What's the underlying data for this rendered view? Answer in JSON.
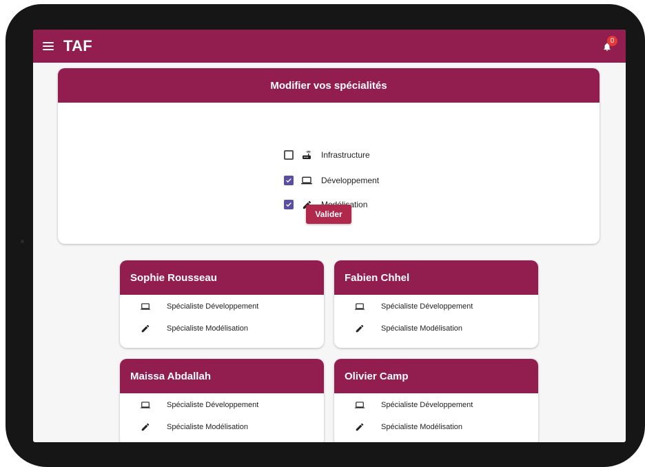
{
  "app": {
    "title": "TAF",
    "notification_count": "0"
  },
  "icons": {
    "menu": "menu-icon",
    "bell": "bell-icon",
    "infrastructure": "router-icon",
    "development": "laptop-icon",
    "modeling": "pencil-icon"
  },
  "colors": {
    "primary": "#921e4f",
    "button": "#b0284c",
    "checkbox": "#5a4ea0",
    "badge": "#e53935"
  },
  "edit": {
    "title": "Modifier vos spécialités",
    "options": [
      {
        "label": "Infrastructure",
        "checked": false
      },
      {
        "label": "Développement",
        "checked": true
      },
      {
        "label": "Modélisation",
        "checked": true
      }
    ],
    "submit_label": "Valider"
  },
  "users": [
    {
      "name": "Sophie Rousseau",
      "specs": [
        "Spécialiste Développement",
        "Spécialiste Modélisation"
      ]
    },
    {
      "name": "Fabien Chhel",
      "specs": [
        "Spécialiste Développement",
        "Spécialiste Modélisation"
      ]
    },
    {
      "name": "Maissa Abdallah",
      "specs": [
        "Spécialiste Développement",
        "Spécialiste Modélisation"
      ]
    },
    {
      "name": "Olivier Camp",
      "specs": [
        "Spécialiste Développement",
        "Spécialiste Modélisation"
      ]
    }
  ]
}
